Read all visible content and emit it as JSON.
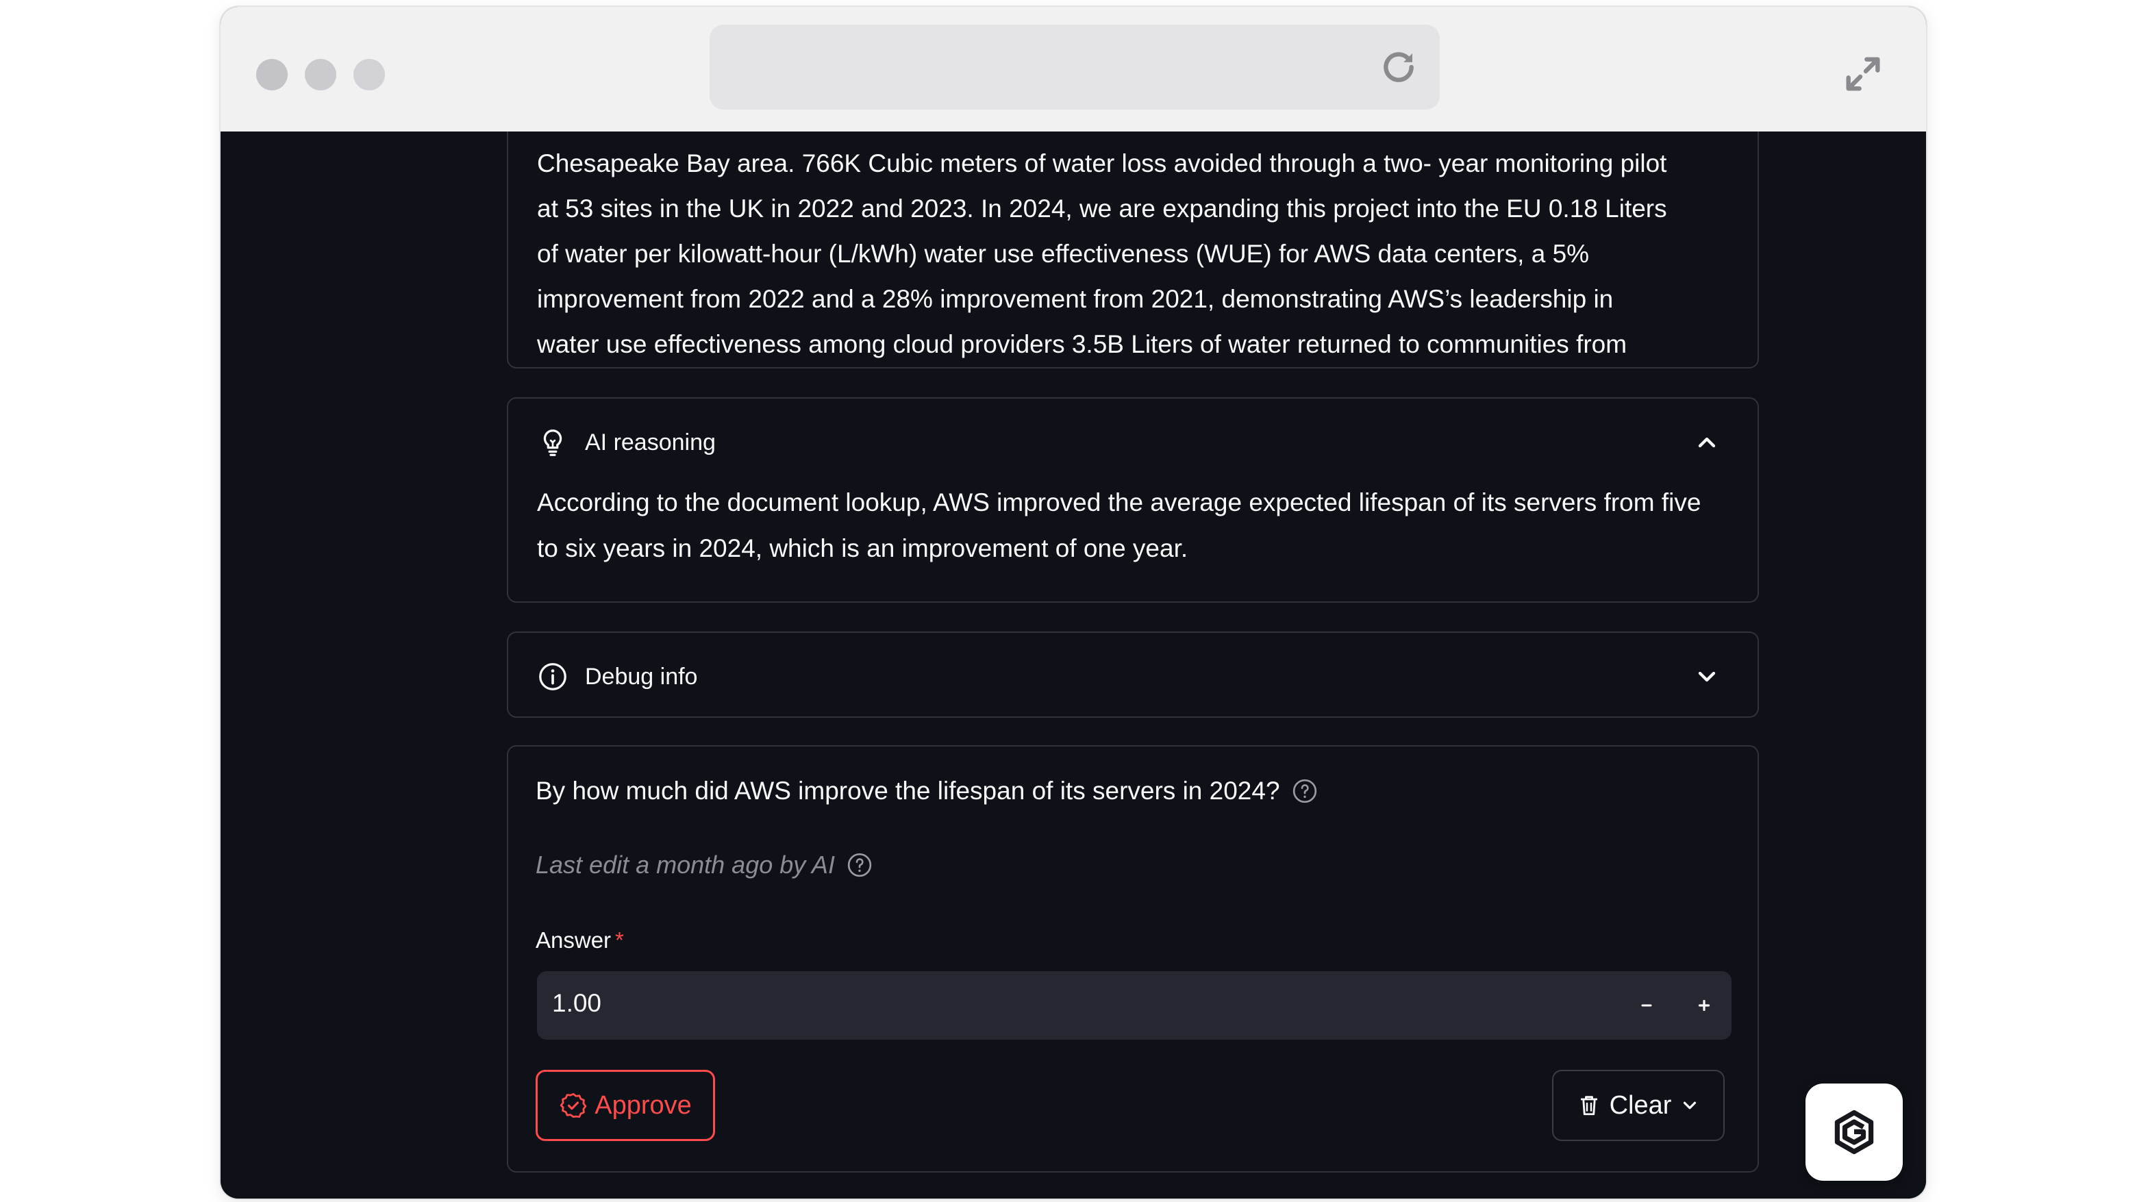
{
  "browser": {
    "window_controls": [
      "close",
      "minimize",
      "zoom"
    ],
    "reload_icon": "reload-icon",
    "expand_icon": "expand-icon"
  },
  "source_excerpt": {
    "lines": [
      "Chesapeake Bay area. 766K Cubic meters of water loss avoided through a two- year monitoring pilot",
      "at 53 sites in the UK in 2022 and 2023. In 2024, we are expanding this project into the EU 0.18 Liters",
      "of water per kilowatt-hour (L/kWh) water use effectiveness (WUE) for AWS data centers, a 5%",
      "improvement from 2022 and a 28% improvement from 2021, demonstrating AWS’s leadership in",
      "water use effectiveness among cloud providers 3.5B Liters of water returned to communities from"
    ]
  },
  "reasoning": {
    "title": "AI reasoning",
    "icon": "lightbulb-icon",
    "expanded": true,
    "text": "According to the document lookup, AWS improved the average expected lifespan of its servers from five to six years in 2024, which is an improvement of one year."
  },
  "debug": {
    "title": "Debug info",
    "icon": "info-icon",
    "expanded": false
  },
  "question": {
    "title": "By how much did AWS improve the lifespan of its servers in 2024?",
    "meta": "Last edit a month ago by AI",
    "answer_label": "Answer",
    "required_mark": "*",
    "answer_value": "1.00",
    "approve_label": "Approve",
    "clear_label": "Clear"
  },
  "colors": {
    "background": "#0e1117",
    "card_border": "#30333d",
    "input_bg": "#262730",
    "accent_red": "#ff4b4b",
    "text": "#fafafa",
    "muted": "#8b8d94"
  }
}
